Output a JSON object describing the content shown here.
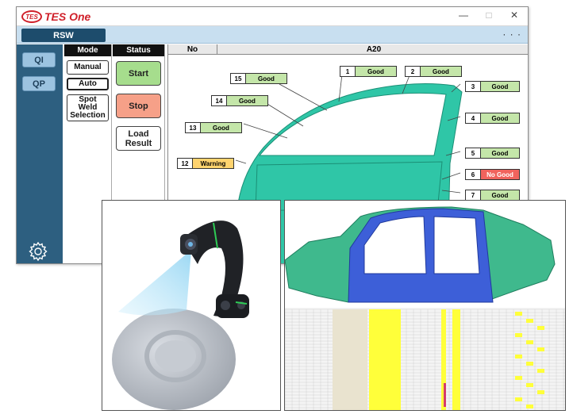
{
  "app": {
    "logo_abbr": "TES",
    "title": "TES One",
    "min_glyph": "—",
    "max_glyph": "□",
    "close_glyph": "✕"
  },
  "tabbar": {
    "active_tab": "RSW",
    "more": "· · ·"
  },
  "rail": {
    "qi": "QI",
    "qp": "QP",
    "settings_icon": "gear-icon"
  },
  "mode": {
    "header": "Mode",
    "manual": "Manual",
    "auto": "Auto",
    "spot": "Spot Weld Selection"
  },
  "status": {
    "header": "Status",
    "start": "Start",
    "stop": "Stop",
    "load": "Load Result"
  },
  "panel": {
    "col_no": "No",
    "col_part": "A20",
    "welds": [
      {
        "no": "1",
        "status": "Good"
      },
      {
        "no": "2",
        "status": "Good"
      },
      {
        "no": "3",
        "status": "Good"
      },
      {
        "no": "4",
        "status": "Good"
      },
      {
        "no": "5",
        "status": "Good"
      },
      {
        "no": "6",
        "status": "No Good"
      },
      {
        "no": "7",
        "status": "Good"
      },
      {
        "no": "12",
        "status": "Warning"
      },
      {
        "no": "13",
        "status": "Good"
      },
      {
        "no": "14",
        "status": "Good"
      },
      {
        "no": "15",
        "status": "Good"
      }
    ]
  },
  "colors": {
    "good": "#c4e6a9",
    "no_good": "#f0635d",
    "warning": "#ffd36e",
    "start_btn": "#a6dd8d",
    "stop_btn": "#f6a088",
    "teal_part": "#2fc6a7",
    "blue_part": "#3d5fd8",
    "highlight": "#ffff3a"
  }
}
